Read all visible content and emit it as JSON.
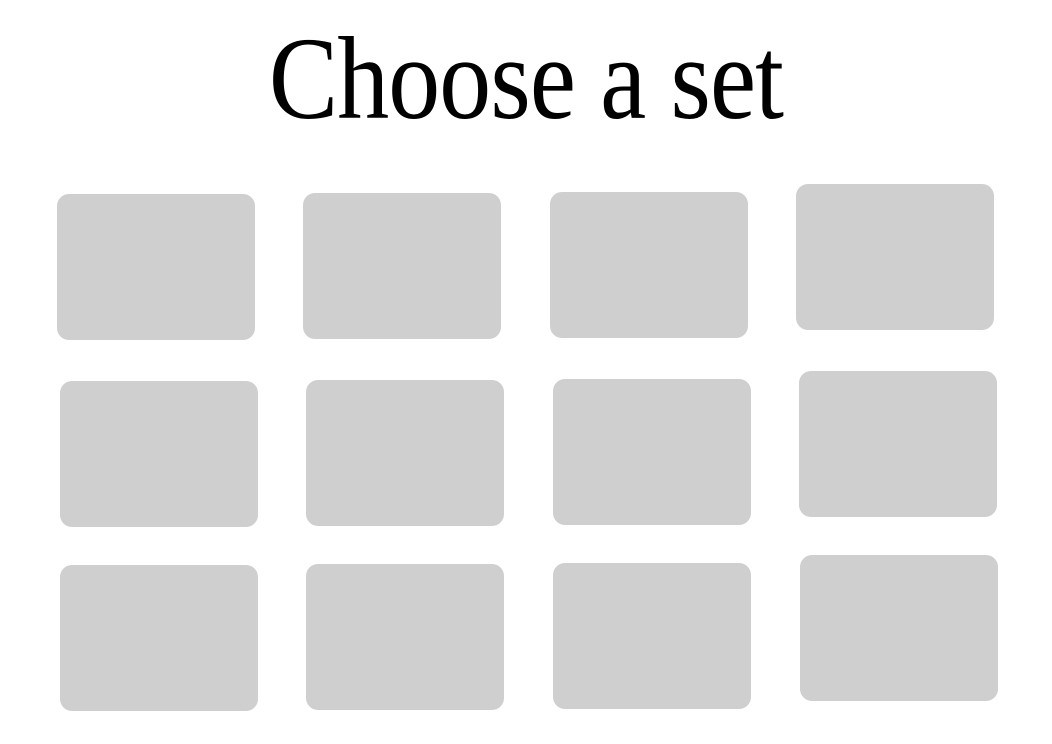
{
  "page": {
    "title": "Choose a set"
  },
  "theme": {
    "card_color": "#d0cfd0",
    "background": "#ffffff",
    "title_color": "#000000"
  },
  "sets": [
    {
      "row": 1,
      "column": 1
    },
    {
      "row": 1,
      "column": 2
    },
    {
      "row": 1,
      "column": 3
    },
    {
      "row": 1,
      "column": 4
    },
    {
      "row": 2,
      "column": 1
    },
    {
      "row": 2,
      "column": 2
    },
    {
      "row": 2,
      "column": 3
    },
    {
      "row": 2,
      "column": 4
    },
    {
      "row": 3,
      "column": 1
    },
    {
      "row": 3,
      "column": 2
    },
    {
      "row": 3,
      "column": 3
    },
    {
      "row": 3,
      "column": 4
    }
  ]
}
